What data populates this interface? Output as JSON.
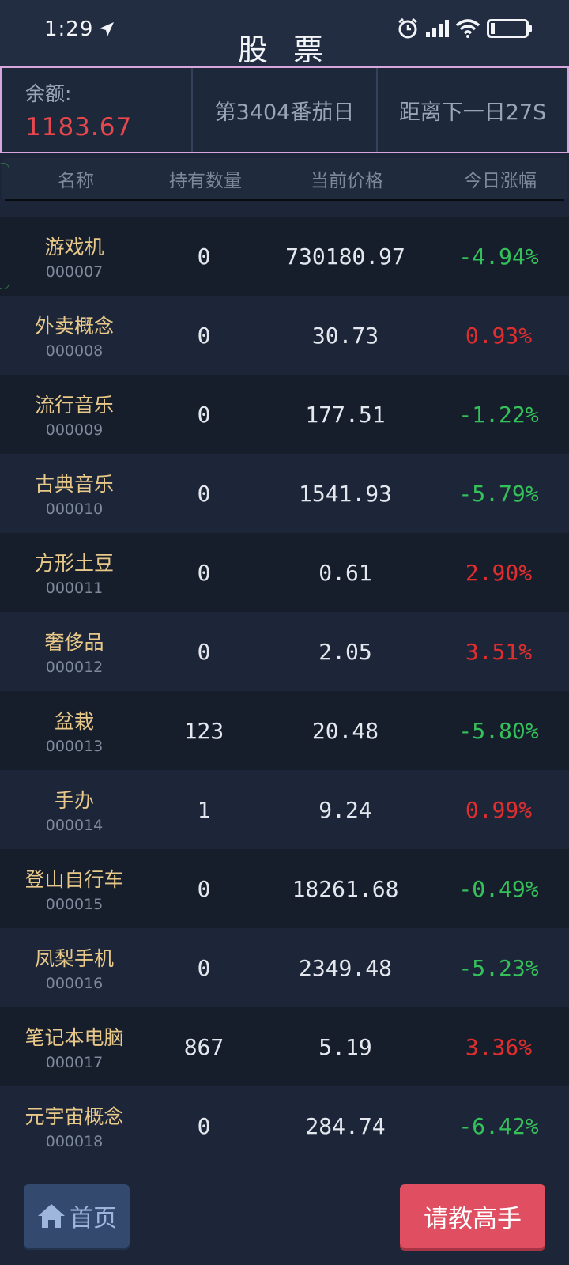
{
  "status": {
    "time": "1:29"
  },
  "header": {
    "title": "股 票"
  },
  "info": {
    "balance_label": "余额:",
    "balance_value": "1183.67",
    "day": "第3404番茄日",
    "countdown": "距离下一日27S"
  },
  "columns": [
    "名称",
    "持有数量",
    "当前价格",
    "今日涨幅"
  ],
  "stocks": [
    {
      "name": "游戏机",
      "code": "000007",
      "qty": "0",
      "price": "730180.97",
      "change": "-4.94%",
      "dir": "down"
    },
    {
      "name": "外卖概念",
      "code": "000008",
      "qty": "0",
      "price": "30.73",
      "change": "0.93%",
      "dir": "up"
    },
    {
      "name": "流行音乐",
      "code": "000009",
      "qty": "0",
      "price": "177.51",
      "change": "-1.22%",
      "dir": "down"
    },
    {
      "name": "古典音乐",
      "code": "000010",
      "qty": "0",
      "price": "1541.93",
      "change": "-5.79%",
      "dir": "down"
    },
    {
      "name": "方形土豆",
      "code": "000011",
      "qty": "0",
      "price": "0.61",
      "change": "2.90%",
      "dir": "up"
    },
    {
      "name": "奢侈品",
      "code": "000012",
      "qty": "0",
      "price": "2.05",
      "change": "3.51%",
      "dir": "up"
    },
    {
      "name": "盆栽",
      "code": "000013",
      "qty": "123",
      "price": "20.48",
      "change": "-5.80%",
      "dir": "down"
    },
    {
      "name": "手办",
      "code": "000014",
      "qty": "1",
      "price": "9.24",
      "change": "0.99%",
      "dir": "up"
    },
    {
      "name": "登山自行车",
      "code": "000015",
      "qty": "0",
      "price": "18261.68",
      "change": "-0.49%",
      "dir": "down"
    },
    {
      "name": "凤梨手机",
      "code": "000016",
      "qty": "0",
      "price": "2349.48",
      "change": "-5.23%",
      "dir": "down"
    },
    {
      "name": "笔记本电脑",
      "code": "000017",
      "qty": "867",
      "price": "5.19",
      "change": "3.36%",
      "dir": "up"
    },
    {
      "name": "元宇宙概念",
      "code": "000018",
      "qty": "0",
      "price": "284.74",
      "change": "-6.42%",
      "dir": "down"
    }
  ],
  "footer": {
    "home_label": "首页",
    "ask_label": "请教高手"
  },
  "colors": {
    "up": "#e02e2e",
    "down": "#34c15a",
    "name": "#e9c98a",
    "accent": "#e04f61"
  }
}
